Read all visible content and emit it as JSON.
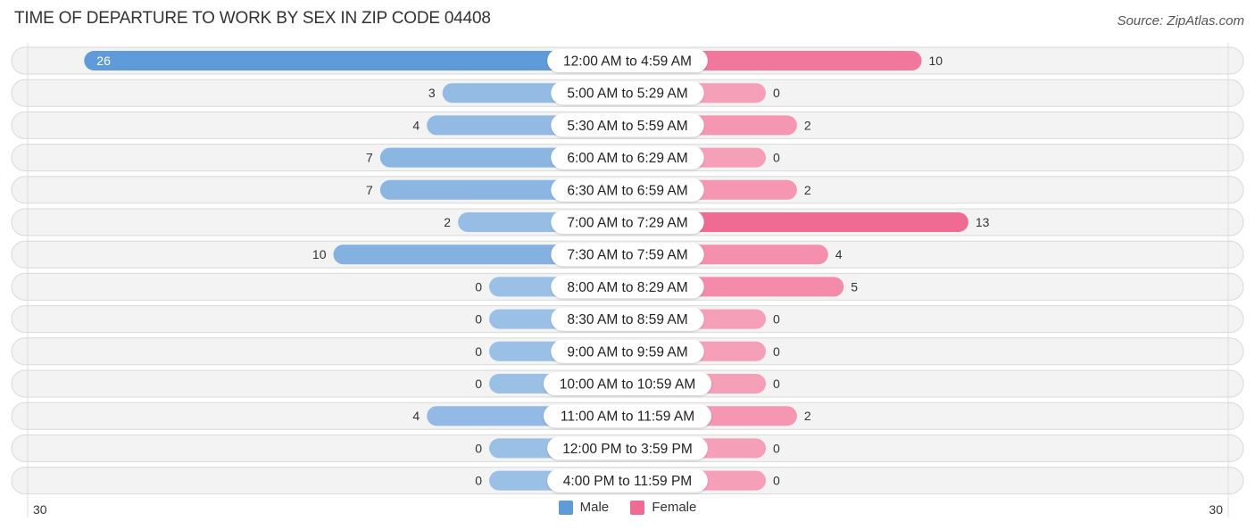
{
  "header": {
    "title": "TIME OF DEPARTURE TO WORK BY SEX IN ZIP CODE 04408",
    "source": "Source: ZipAtlas.com"
  },
  "colors": {
    "male_strong": "#5f9bd8",
    "male_light": "#a6c6e8",
    "female_strong": "#f06b93",
    "female_light": "#f7a8c0",
    "row_bg": "#f3f3f3"
  },
  "chart_data": {
    "type": "bar",
    "orientation": "horizontal-diverging",
    "title": "TIME OF DEPARTURE TO WORK BY SEX IN ZIP CODE 04408",
    "categories": [
      "12:00 AM to 4:59 AM",
      "5:00 AM to 5:29 AM",
      "5:30 AM to 5:59 AM",
      "6:00 AM to 6:29 AM",
      "6:30 AM to 6:59 AM",
      "7:00 AM to 7:29 AM",
      "7:30 AM to 7:59 AM",
      "8:00 AM to 8:29 AM",
      "8:30 AM to 8:59 AM",
      "9:00 AM to 9:59 AM",
      "10:00 AM to 10:59 AM",
      "11:00 AM to 11:59 AM",
      "12:00 PM to 3:59 PM",
      "4:00 PM to 11:59 PM"
    ],
    "series": [
      {
        "name": "Male",
        "values": [
          26,
          3,
          4,
          7,
          7,
          2,
          10,
          0,
          0,
          0,
          0,
          4,
          0,
          0
        ]
      },
      {
        "name": "Female",
        "values": [
          10,
          0,
          2,
          0,
          2,
          13,
          4,
          5,
          0,
          0,
          0,
          2,
          0,
          0
        ]
      }
    ],
    "axis": {
      "left_label": "30",
      "right_label": "30",
      "range": [
        0,
        30
      ]
    },
    "legend": {
      "position": "bottom-center",
      "entries": [
        "Male",
        "Female"
      ]
    },
    "grid": false
  }
}
